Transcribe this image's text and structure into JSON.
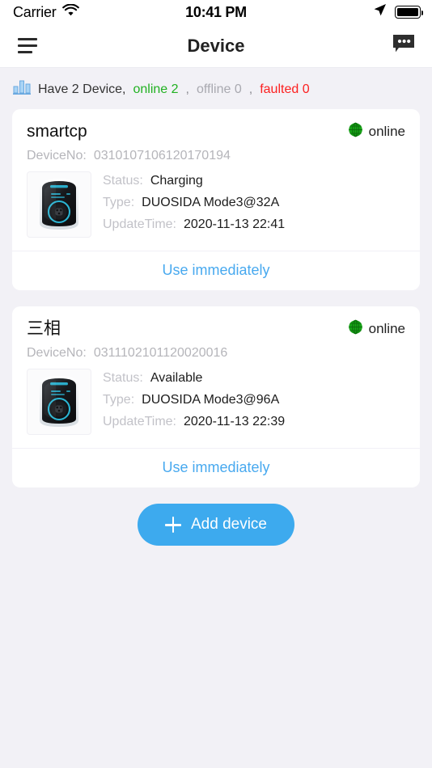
{
  "status_bar": {
    "carrier": "Carrier",
    "time": "10:41 PM",
    "wifi_icon": "wifi-icon",
    "location_icon": "location-arrow-icon",
    "battery_icon": "battery-full-icon"
  },
  "nav": {
    "menu_icon": "hamburger-menu-icon",
    "title": "Device",
    "message_icon": "message-bubble-icon"
  },
  "summary": {
    "chart_icon": "bar-chart-icon",
    "total_text": "Have 2 Device,",
    "online_text": "online 2",
    "comma1": ",",
    "offline_text": "offline 0",
    "comma2": ",",
    "faulted_text": "faulted 0",
    "colors": {
      "online": "#21b121",
      "offline": "#a9a9b0",
      "faulted": "#fc2020"
    }
  },
  "labels": {
    "device_no": "DeviceNo:",
    "status": "Status:",
    "type": "Type:",
    "update_time": "UpdateTime:",
    "use_immediately": "Use immediately",
    "online_badge": "online",
    "globe_icon": "globe-icon",
    "charger_icon": "ev-charger-image"
  },
  "devices": [
    {
      "name": "smartcp",
      "connectivity": "online",
      "device_no": "0310107106120170194",
      "status": "Charging",
      "type": "DUOSIDA Mode3@32A",
      "update_time": "2020-11-13 22:41",
      "action": "Use immediately"
    },
    {
      "name": "三相",
      "connectivity": "online",
      "device_no": "0311102101120020016",
      "status": "Available",
      "type": "DUOSIDA Mode3@96A",
      "update_time": "2020-11-13 22:39",
      "action": "Use immediately"
    }
  ],
  "add_button": {
    "label": "Add device",
    "icon": "plus-icon",
    "color": "#3daaee"
  }
}
